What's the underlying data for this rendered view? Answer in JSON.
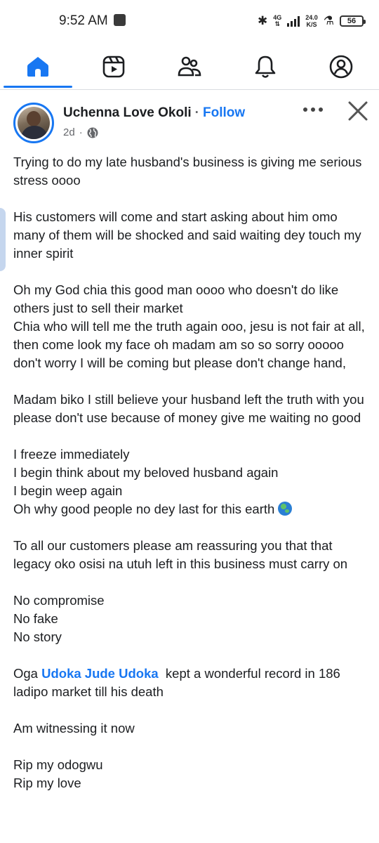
{
  "status_bar": {
    "time": "9:52 AM",
    "network": "4G",
    "speed_value": "24.0",
    "speed_unit": "K/S",
    "battery": "56"
  },
  "nav": {
    "active": "home",
    "items": [
      "home",
      "video",
      "friends",
      "notifications",
      "profile"
    ],
    "accent_color": "#1877f2"
  },
  "post": {
    "author": "Uchenna Love Okoli",
    "separator": "·",
    "follow_label": "Follow",
    "time_ago": "2d",
    "meta_separator": "·",
    "privacy_icon": "globe-icon",
    "paragraphs": [
      [
        "Trying to do my late husband's business is giving me serious stress oooo"
      ],
      [
        "His customers will come and start asking about him omo many of them will be shocked and said waiting dey touch my inner spirit"
      ],
      [
        "Oh my God chia this good man oooo who doesn't do like others just to sell their market",
        "Chia who will tell me the truth again ooo, jesu is not fair at all, then come look my face oh madam am so so sorry ooooo don't worry I will be coming but please don't change hand,"
      ],
      [
        "Madam biko I still believe your husband left the truth with you please don't use because of money give me waiting no good"
      ],
      [
        "I freeze immediately",
        "I begin think about my beloved husband again",
        "I begin weep again",
        "Oh why good people no dey last for this earth"
      ],
      [
        "To all our customers please am reassuring you that that legacy oko osisi na utuh left in this business must carry on"
      ],
      [
        "No compromise",
        "No fake",
        "No story"
      ],
      [
        "Am witnessing it now"
      ],
      [
        "Rip my odogwu",
        "Rip my love"
      ]
    ],
    "mention_paragraph": {
      "prefix": "Oga ",
      "mention": "Udoka Jude Udoka",
      "suffix": "  kept a wonderful record in 186 ladipo market till his death"
    }
  }
}
